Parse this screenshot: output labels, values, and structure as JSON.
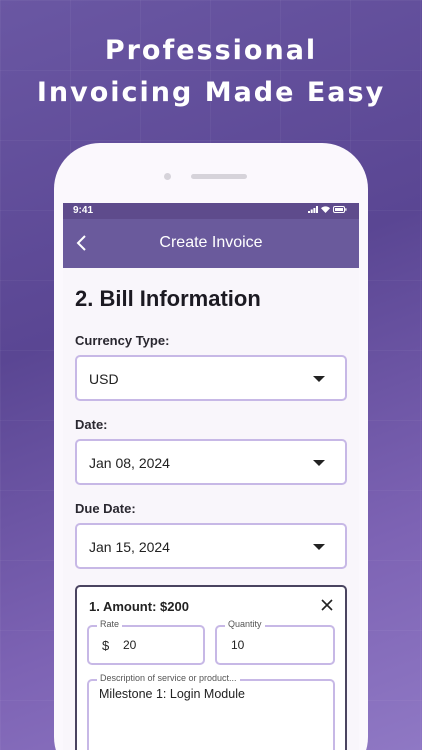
{
  "promo": {
    "headline_line1": "Professional",
    "headline_line2": "Invoicing Made Easy"
  },
  "status_bar": {
    "time": "9:41"
  },
  "app_bar": {
    "title": "Create Invoice"
  },
  "section": {
    "title": "2. Bill Information"
  },
  "currency": {
    "label": "Currency Type:",
    "value": "USD"
  },
  "date": {
    "label": "Date:",
    "value": "Jan 08, 2024"
  },
  "due_date": {
    "label": "Due Date:",
    "value": "Jan 15, 2024"
  },
  "item": {
    "title": "1. Amount: $200",
    "rate_label": "Rate",
    "rate_prefix": "$",
    "rate_value": "20",
    "quantity_label": "Quantity",
    "quantity_value": "10",
    "description_placeholder": "Description of service or product...",
    "description_value": "Milestone 1: Login Module"
  },
  "icons": {
    "back": "chevron-left-icon",
    "dropdown": "caret-down-icon",
    "remove": "close-icon",
    "signal": "signal-icon",
    "wifi": "wifi-icon",
    "battery": "battery-icon"
  },
  "colors": {
    "app_bar": "#6a5a9c",
    "status_bar": "#5e4b8c",
    "field_border": "#c7b8e6",
    "background_top": "#5a4693",
    "background_bottom": "#8f78c4"
  }
}
